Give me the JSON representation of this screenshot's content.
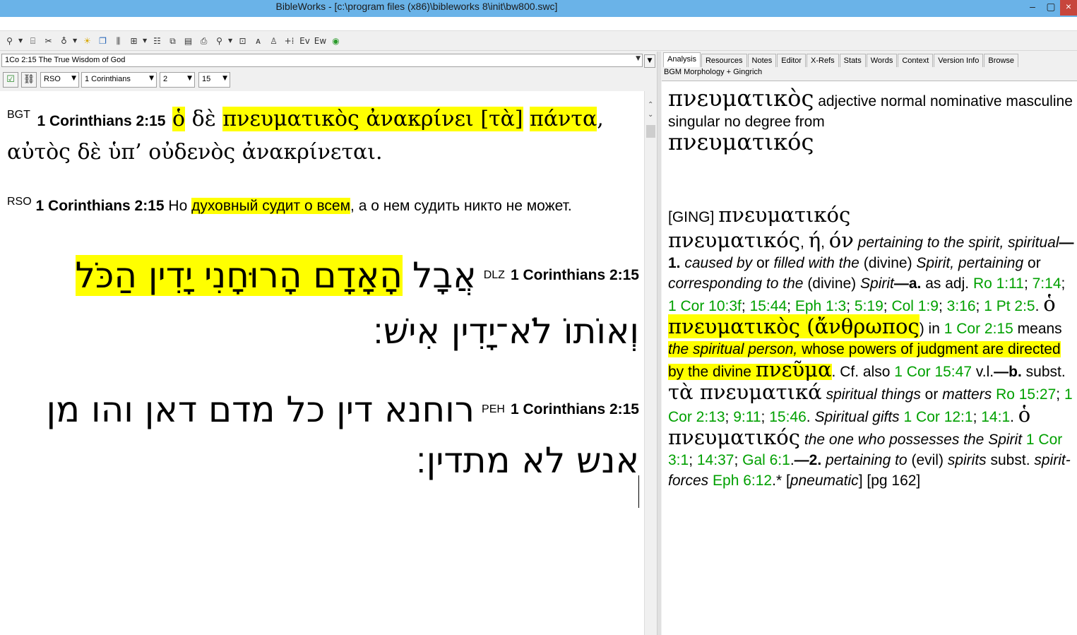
{
  "window": {
    "title": "BibleWorks - [c:\\program files (x86)\\bibleworks 8\\init\\bw800.swc]"
  },
  "toolbar": {
    "icons": [
      "search-icon",
      "setup-icon",
      "tools-icon",
      "bookmark-icon",
      "lamp-icon",
      "window-icon",
      "columns-icon",
      "grid-icon",
      "list-icon",
      "copy-icon",
      "page-icon",
      "print-icon",
      "highlight-icon",
      "layout-icon",
      "notes-icon",
      "person-icon",
      "add-icon",
      "ev-icon",
      "ew-icon",
      "globe-icon"
    ]
  },
  "left": {
    "verse_combo": "1Co 2:15 The True Wisdom of God",
    "version_select": "RSO",
    "book_select": "1 Corinthians",
    "chapter_select": "2",
    "verse_select": "15",
    "bgt": {
      "label": "BGT",
      "ref": "1 Corinthians 2:15",
      "w1": "ὁ",
      "w2": "δὲ",
      "w3": "πνευματικὸς ἀνακρίνει [τὰ]",
      "w4": "πάντα",
      "w5": ", αὐτὸς δὲ ὑπ’ οὐδενὸς ἀνακρίνεται."
    },
    "rso": {
      "label": "RSO",
      "ref": "1 Corinthians 2:15",
      "pre": "Но",
      "hl": "духовный судит о всем",
      "post": ", а о нем судить никто не может."
    },
    "dlz": {
      "label": "DLZ",
      "ref": "1 Corinthians 2:15",
      "w1": "אֲבָל",
      "hl": "הָאָדָם הָרוּחָנִי יָדִין הַכֹּל",
      "line2": "וְאוֹתוֹ לֹא־יָדִין אִישׁ׃"
    },
    "peh": {
      "label": "PEH",
      "ref": "1 Corinthians 2:15",
      "line1": "רוחנא דין כל מדם דאן והו מן",
      "line2": "אנש לא מתדין׃"
    }
  },
  "right": {
    "tabs": [
      "Analysis",
      "Resources",
      "Notes",
      "Editor",
      "X-Refs",
      "Stats",
      "Words",
      "Context",
      "Version Info",
      "Browse"
    ],
    "active_tab": "Analysis",
    "subtitle": "BGM Morphology + Gingrich",
    "analysis": {
      "word": "πνευματικὸς",
      "desc": "adjective normal nominative masculine singular no degree from",
      "lemma": "πνευματικός"
    },
    "ging": {
      "tag": "[GING]",
      "lemma": "πνευματικός",
      "head": "πνευματικός",
      "eta": "ή",
      "on": "όν",
      "d1": "pertaining to the spirit, spiritual",
      "d2": "—1.",
      "d3": "caused by",
      "d4": "or",
      "d5": "filled with the",
      "d6": "(divine)",
      "d7": "Spirit, pertaining",
      "d8": "or",
      "d9": "corresponding to the",
      "d10": "(divine)",
      "d11": "Spirit",
      "d12": "—a.",
      "d13": "as adj.",
      "r1": "Ro 1:11",
      "r2": "7:14",
      "r3": "1 Cor 10:3f",
      "r4": "15:44",
      "r5": "Eph 1:3",
      "r6": "5:19",
      "r7": "Col 1:9",
      "r8": "3:16",
      "r9": "1 Pt 2:5",
      "g1": "ὁ",
      "g2": "πνευματικὸς (ἄνθρωπος",
      "close": ")",
      "in": "in",
      "r10": "1 Cor 2:15",
      "means": "means",
      "hl1": "the spiritual person,",
      "hl2": "whose powers of judgment are directed by the divine",
      "g3": "πνεῦμα",
      "cf": ". Cf. also",
      "r11": "1 Cor 15:47",
      "vl": "v.l.",
      "b": "—b.",
      "subst": "subst.",
      "g4": "τὰ πνευματικά",
      "st": "spiritual things",
      "or": "or",
      "matters": "matters",
      "r12": "Ro 15:27",
      "r13": "1 Cor 2:13",
      "r14": "9:11",
      "r15": "15:46",
      "sg": "Spiritual gifts",
      "r16": "1 Cor 12:1",
      "r17": "14:1",
      "g5": "ὁ πνευματικός",
      "owho": "the one who possesses the Spirit",
      "r18": "1 Cor 3:1",
      "r19": "14:37",
      "r20": "Gal 6:1",
      "two": "—2.",
      "pert": "pertaining to",
      "evil": "(evil)",
      "spirits": "spirits",
      "subst2": "subst.",
      "sf": "spirit-forces",
      "r21": "Eph 6:12",
      "star": ".*",
      "pn": "pneumatic",
      "pg": "] [pg 162]"
    }
  }
}
